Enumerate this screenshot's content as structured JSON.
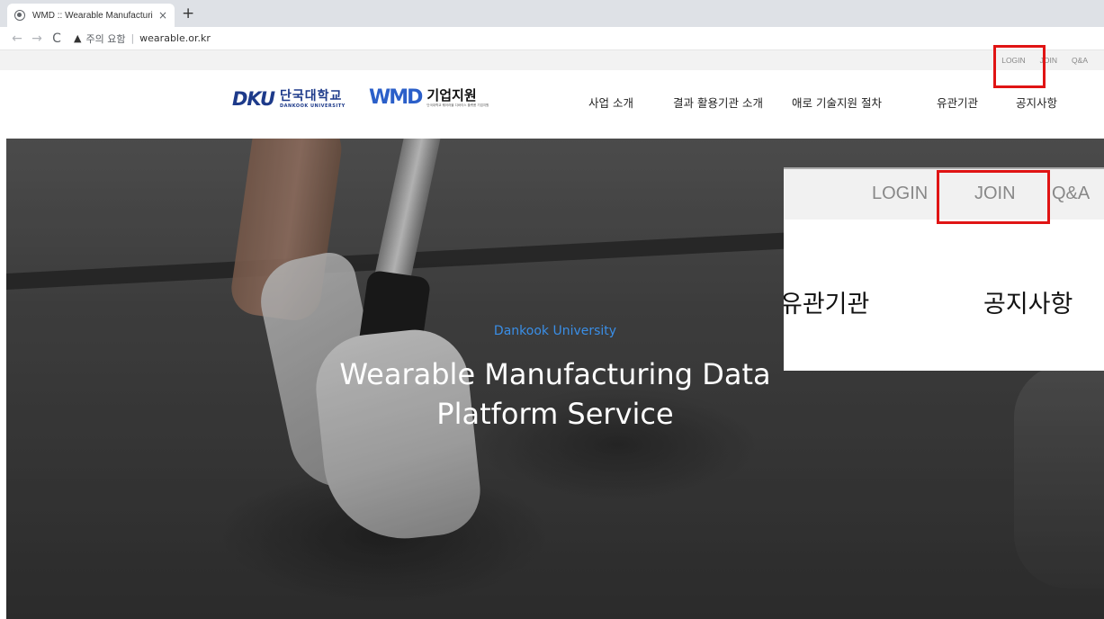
{
  "browser": {
    "tab_title": "WMD :: Wearable Manufacturin",
    "tab_close": "×",
    "new_tab": "+",
    "back": "←",
    "forward": "→",
    "reload": "C",
    "warning_icon": "▲",
    "security_status": "주의 요함",
    "separator": "|",
    "url": "wearable.or.kr"
  },
  "header": {
    "util_links": {
      "login": "LOGIN",
      "join": "JOIN",
      "qna": "Q&A"
    },
    "logo_dku": {
      "mark": "DKU",
      "name_ko": "단국대학교",
      "name_en": "DANKOOK UNIVERSITY"
    },
    "logo_wmd": {
      "mark": "WMD",
      "name_ko": "기업지원",
      "subtitle": "단국대학교 웨어러블 디바이스 플랫폼 기업지원"
    },
    "nav": [
      "사업 소개",
      "결과 활용기관 소개",
      "애로 기술지원 절차",
      "유관기관",
      "공지사항"
    ]
  },
  "hero": {
    "label": "Dankook University",
    "title_line1": "Wearable Manufacturing Data",
    "title_line2": "Platform Service"
  },
  "zoom": {
    "util_links": {
      "login": "LOGIN",
      "join": "JOIN",
      "qna": "Q&A"
    },
    "nav": [
      "유관기관",
      "공지사항"
    ]
  },
  "colors": {
    "highlight": "#e01414",
    "brand_blue": "#1d3a8a",
    "hero_label": "#3a8ee6"
  }
}
